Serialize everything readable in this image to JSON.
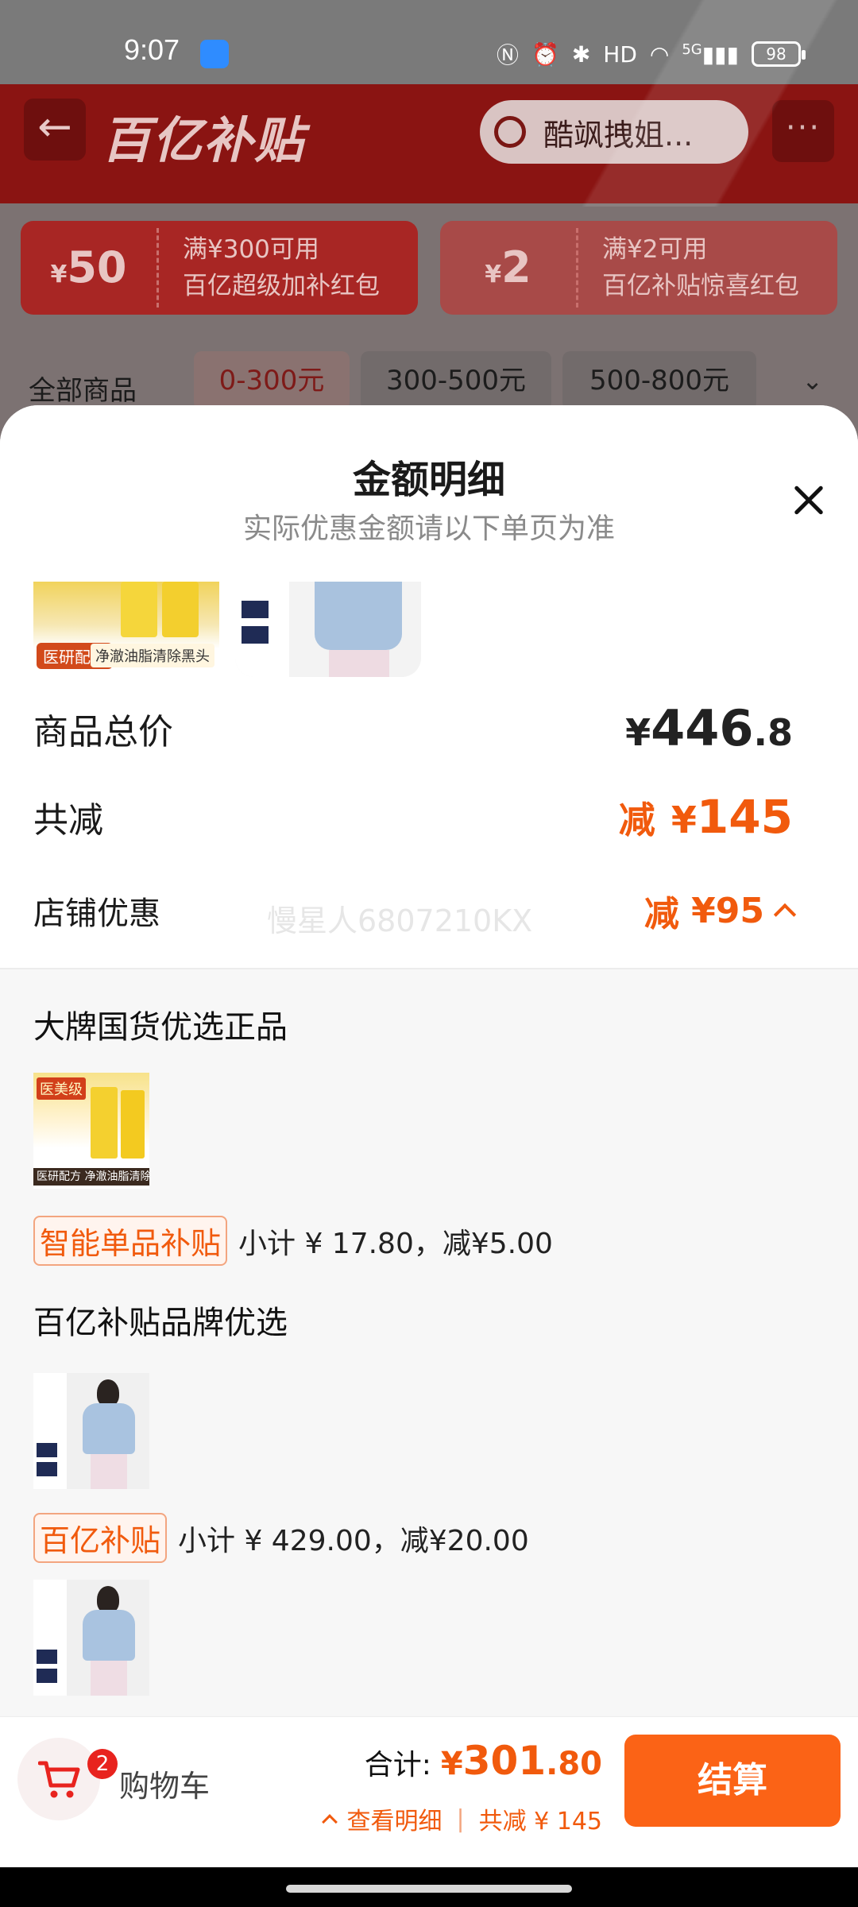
{
  "status_bar": {
    "time": "9:07",
    "icons": [
      "nfc-icon",
      "alarm-icon",
      "bluetooth-icon",
      "hd-icon",
      "wifi-icon",
      "signal-icon"
    ],
    "signal_label": "5G",
    "hd_label": "HD",
    "battery": "98"
  },
  "header": {
    "title": "百亿补贴",
    "search_text": "酷飒拽姐...",
    "more": "···"
  },
  "coupons": [
    {
      "currency": "¥",
      "amount": "50",
      "line1": "满¥300可用",
      "line2": "百亿超级加补红包"
    },
    {
      "currency": "¥",
      "amount": "2",
      "line1": "满¥2可用",
      "line2": "百亿补贴惊喜红包"
    }
  ],
  "filters": {
    "all": "全部商品",
    "chips": [
      "0-300元",
      "300-500元",
      "500-800元"
    ]
  },
  "sheet": {
    "title": "金额明细",
    "subtitle": "实际优惠金额请以下单页为准",
    "thumb_texts": {
      "skin_tag": "医研配方",
      "skin_desc": "净澈油脂清除黑头"
    },
    "total_price_label": "商品总价",
    "total_price": {
      "currency": "¥",
      "int": "446",
      "dec": ".8"
    },
    "total_reduce_label": "共减",
    "total_reduce": {
      "prefix": "减",
      "currency": "¥",
      "amount": "145"
    },
    "shop_discount_label": "店铺优惠",
    "watermark": "慢星人6807210KX",
    "shop_discount": {
      "prefix": "减",
      "currency": "¥",
      "amount": "95"
    },
    "groups": [
      {
        "title": "大牌国货优选正品",
        "image_top": "医美级",
        "image_bottom": "医研配方 净澈油脂清除黑头",
        "tag": "智能单品补贴",
        "subtotal": "小计 ¥ 17.80，减¥5.00"
      },
      {
        "title": "百亿补贴品牌优选",
        "tag": "百亿补贴",
        "subtotal": "小计 ¥ 429.00，减¥20.00"
      }
    ]
  },
  "bottom_bar": {
    "cart_label": "购物车",
    "cart_count": "2",
    "total_label": "合计:",
    "total": {
      "currency": "¥",
      "int": "301",
      "dec": ".80"
    },
    "detail_link": "查看明细",
    "separator": "|",
    "reduce_text": "共减 ¥ 145",
    "checkout": "结算"
  },
  "colors": {
    "accent": "#f15a0d",
    "checkout": "#fb6316",
    "brand_red": "#e02a23",
    "badge": "#e8231e"
  }
}
